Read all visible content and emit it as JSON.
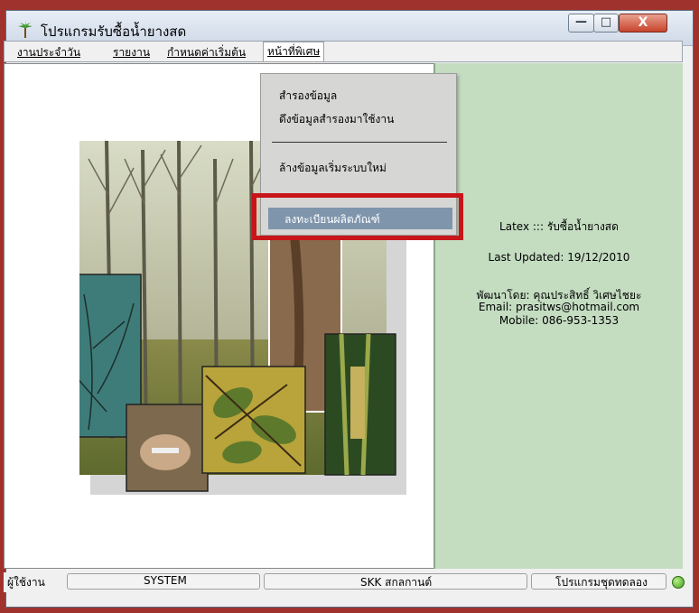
{
  "window": {
    "title": "โปรแกรมรับซื้อน้ำยางสด",
    "minimize_glyph": "—",
    "maximize_glyph": "□",
    "close_glyph": "X"
  },
  "menubar": {
    "items": [
      {
        "label": "งานประจำวัน"
      },
      {
        "label": "รายงาน"
      },
      {
        "label": "กำหนดค่าเริ่มต้น"
      },
      {
        "label": "หน้าที่พิเศษ"
      }
    ]
  },
  "dropdown": {
    "items": [
      {
        "label": "สำรองข้อมูล"
      },
      {
        "label": "ดึงข้อมูลสำรองมาใช้งาน"
      },
      {
        "label": "ล้างข้อมูลเริ่มระบบใหม่"
      },
      {
        "label": "ลงทะเบียนผลิตภัณฑ์"
      }
    ],
    "selected_index": 3
  },
  "info": {
    "line1": "Latex ::: รับซื้อน้ำยางสด",
    "line2": "Last Updated: 19/12/2010",
    "line3": "พัฒนาโดย: คุณประสิทธิ์ วิเศษไชยะ",
    "line4": "Email: prasitws@hotmail.com",
    "line5": "Mobile: 086-953-1353"
  },
  "statusbar": {
    "user_label": "ผู้ใช้งาน",
    "user_value": "SYSTEM",
    "company": "SKK สกลกานต์",
    "mode": "โปรแกรมชุดทดลอง"
  },
  "colors": {
    "border": "#a0322d",
    "panel": "#c4ddc1",
    "highlight": "#c8151a",
    "selected": "#7e95ac"
  }
}
